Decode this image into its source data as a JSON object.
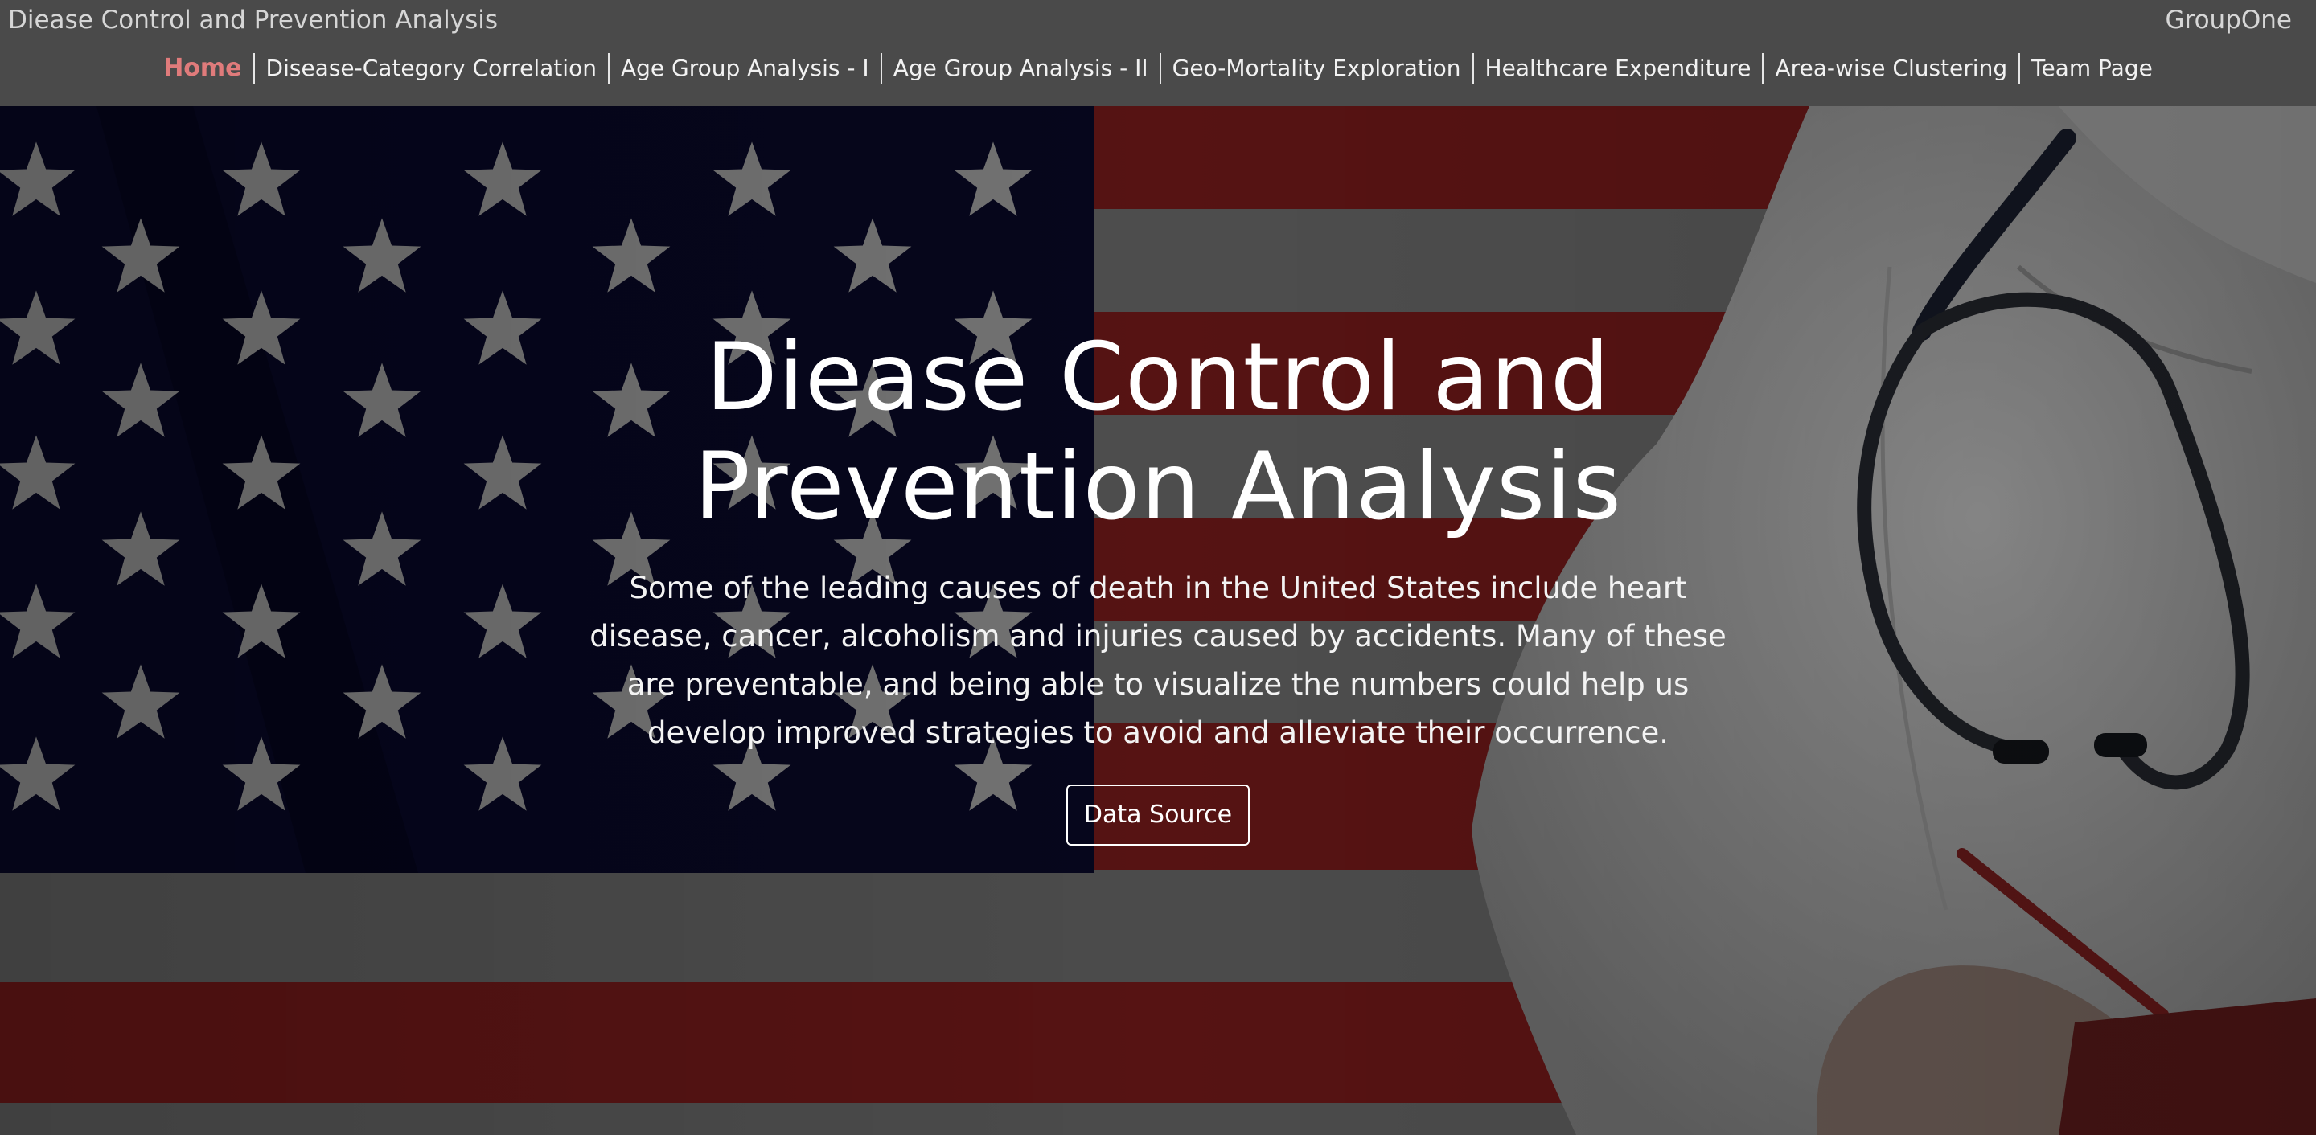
{
  "header": {
    "brand": "Diease Control and Prevention Analysis",
    "group": "GroupOne",
    "nav": [
      {
        "label": "Home",
        "active": true
      },
      {
        "label": "Disease-Category Correlation"
      },
      {
        "label": "Age Group Analysis - I"
      },
      {
        "label": "Age Group Analysis - II"
      },
      {
        "label": "Geo-Mortality Exploration"
      },
      {
        "label": "Healthcare Expenditure"
      },
      {
        "label": "Area-wise Clustering"
      },
      {
        "label": "Team Page"
      }
    ]
  },
  "hero": {
    "title_line1": "Diease Control and",
    "title_line2": "Prevention Analysis",
    "description": "Some of the leading causes of death in the United States include heart disease, cancer, alcoholism and injuries caused by accidents. Many of these are preventable, and being able to visualize the numbers could help us develop improved strategies to avoid and alleviate their occurrence.",
    "button_label": "Data Source",
    "background_image": "american-flag-with-doctor-stethoscope"
  },
  "colors": {
    "header_bg": "#4a4a4a",
    "active_nav": "#e07b7b",
    "canton": "#0a0a2e",
    "stripe_red": "#8b1f1f",
    "stripe_white": "#7d7d7d"
  }
}
